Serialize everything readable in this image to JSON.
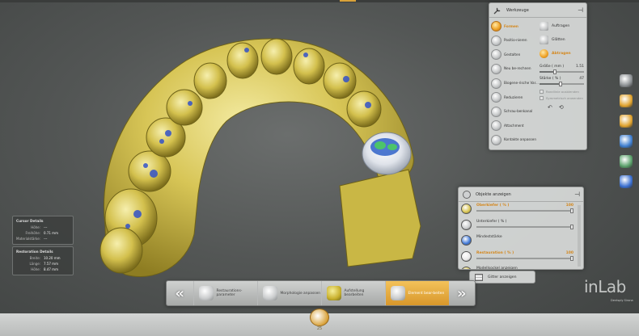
{
  "colors": {
    "accent": "#d4861a",
    "model_gold": "#d9c85a",
    "panel_bg": "#d8dad9",
    "active_step": "#e3a338"
  },
  "tools_panel": {
    "title": "Werkzeuge",
    "pin_icon": "pin-icon",
    "left_items": [
      {
        "label": "Formen",
        "active": true
      },
      {
        "label": "Positio-nieren",
        "active": false
      },
      {
        "label": "Gestalten",
        "active": false
      },
      {
        "label": "Neu be-rechnen",
        "active": false
      },
      {
        "label": "Biogene-rische Var...",
        "active": false
      },
      {
        "label": "Reduzieren",
        "active": false
      },
      {
        "label": "Schrau-benkanal",
        "active": false
      },
      {
        "label": "Attachment",
        "active": false
      },
      {
        "label": "Kontakte anpassen",
        "active": false
      }
    ],
    "right_items": [
      {
        "label": "Auftragen",
        "active": false
      },
      {
        "label": "Glätten",
        "active": false
      },
      {
        "label": "Abtragen",
        "active": true
      }
    ],
    "size_label": "Größe ( mm )",
    "size_value": "1.51",
    "size_fraction": 0.35,
    "strength_label": "Stärke ( % )",
    "strength_value": "47",
    "strength_fraction": 0.47,
    "check1": "Randlinie ausblenden",
    "check2": "Symmetrisch anwenden"
  },
  "objects_panel": {
    "title": "Objekte anzeigen",
    "rows": [
      {
        "label": "Oberkiefer ( % )",
        "value": "100",
        "highlight": true,
        "ball": "#d8c44e",
        "fraction": 1.0
      },
      {
        "label": "Unterkiefer ( % )",
        "value": "",
        "highlight": false,
        "ball": "#c9cbcc",
        "fraction": 1.0
      },
      {
        "label": "Mindeststärke",
        "value": "",
        "highlight": false,
        "ball": "#3f78d8",
        "fraction": null
      },
      {
        "label": "Restauration ( % )",
        "value": "100",
        "highlight": true,
        "ball": "#e8e8e8",
        "fraction": 1.0
      },
      {
        "label": "Modellsockel anzeigen",
        "value": "",
        "highlight": false,
        "ball": "#d8c44e",
        "fraction": null
      }
    ]
  },
  "grid_button": {
    "label": "Gitter anzeigen"
  },
  "cursor_details": {
    "title": "Cursor Details",
    "rows": [
      {
        "k": "Höhe:",
        "v": "---"
      },
      {
        "k": "Freihöhe:",
        "v": "0.71 mm"
      },
      {
        "k": "Materialstärke:",
        "v": "---"
      }
    ]
  },
  "restoration_details": {
    "title": "Restoration Details",
    "rows": [
      {
        "k": "Breite:",
        "v": "10.20 mm"
      },
      {
        "k": "Länge:",
        "v": "7.57 mm"
      },
      {
        "k": "Höhe:",
        "v": "8.47 mm"
      }
    ]
  },
  "workflow": {
    "prev_icon": "double-chevron-left-icon",
    "next_icon": "double-chevron-right-icon",
    "steps": [
      {
        "label": "Restaurations-parameter",
        "active": false,
        "style": "white"
      },
      {
        "label": "Morphologie anpassen",
        "active": false,
        "style": "white"
      },
      {
        "label": "Aufstellung bearbeiten",
        "active": false,
        "style": "yellow"
      },
      {
        "label": "Element bear-beiten",
        "active": true,
        "style": "white"
      }
    ]
  },
  "right_toolbar": [
    {
      "icon": "cube-view-icon",
      "color": "#8b8f92"
    },
    {
      "icon": "tooth-rotate-icon",
      "color": "#e0a32e"
    },
    {
      "icon": "tooth-tool-icon",
      "color": "#e0a32e"
    },
    {
      "icon": "book-icon",
      "color": "#3f7fd0"
    },
    {
      "icon": "screenshot-icon",
      "color": "#5aa06a"
    },
    {
      "icon": "download-icon",
      "color": "#3a6fd0"
    }
  ],
  "bottom": {
    "tooth_number": "25"
  },
  "logo": {
    "text": "inLab",
    "sub": "Dentsply Sirona"
  }
}
